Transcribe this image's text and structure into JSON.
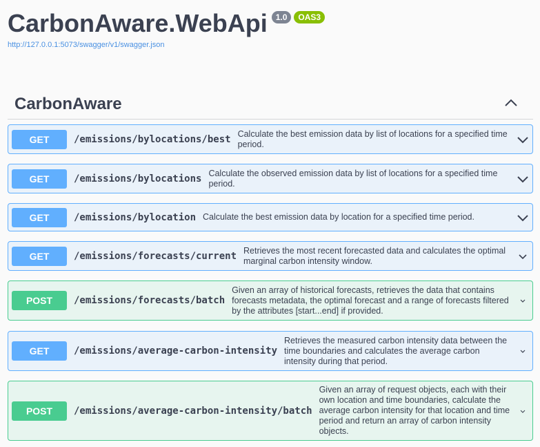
{
  "info": {
    "title": "CarbonAware.WebApi",
    "version": "1.0",
    "oas": "OAS3",
    "spec_url": "http://127.0.0.1:5073/swagger/v1/swagger.json"
  },
  "tag": {
    "name": "CarbonAware",
    "toggle_icon": "chevron-up-icon"
  },
  "operations": [
    {
      "method": "GET",
      "path": "/emissions/bylocations/best",
      "summary": "Calculate the best emission data by list of locations for a specified time period."
    },
    {
      "method": "GET",
      "path": "/emissions/bylocations",
      "summary": "Calculate the observed emission data by list of locations for a specified time period."
    },
    {
      "method": "GET",
      "path": "/emissions/bylocation",
      "summary": "Calculate the best emission data by location for a specified time period."
    },
    {
      "method": "GET",
      "path": "/emissions/forecasts/current",
      "summary": "Retrieves the most recent forecasted data and calculates the optimal marginal carbon intensity window."
    },
    {
      "method": "POST",
      "path": "/emissions/forecasts/batch",
      "summary": "Given an array of historical forecasts, retrieves the data that contains forecasts metadata, the optimal forecast and a range of forecasts filtered by the attributes [start...end] if provided."
    },
    {
      "method": "GET",
      "path": "/emissions/average-carbon-intensity",
      "summary": "Retrieves the measured carbon intensity data between the time boundaries and calculates the average carbon intensity during that period."
    },
    {
      "method": "POST",
      "path": "/emissions/average-carbon-intensity/batch",
      "summary": "Given an array of request objects, each with their own location and time boundaries, calculate the average carbon intensity for that location and time period and return an array of carbon intensity objects."
    }
  ],
  "colors": {
    "get": "#61affe",
    "post": "#49cc90",
    "text": "#3b4151",
    "link": "#4990e2",
    "version_badge": "#7d8492",
    "oas_badge": "#89bf04"
  }
}
